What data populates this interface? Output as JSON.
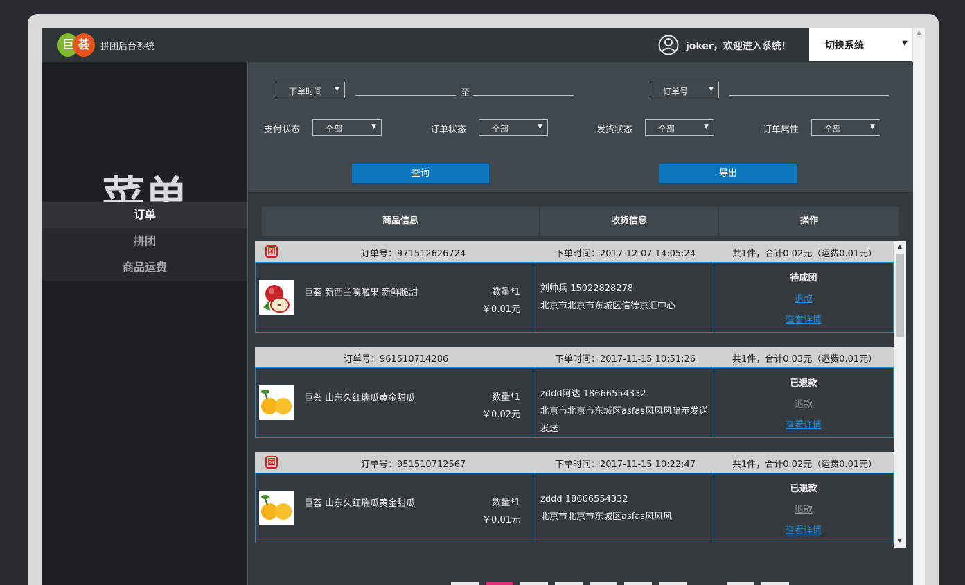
{
  "app": {
    "logo_left": "巨",
    "logo_right": "荟",
    "system_title": "拼团后台系统",
    "welcome": "joker，欢迎进入系统！",
    "switch_label": "切换系统"
  },
  "sidebar": {
    "title": "菜单",
    "items": [
      {
        "label": "订单",
        "active": true
      },
      {
        "label": "拼团",
        "active": false
      },
      {
        "label": "商品运费",
        "active": false
      }
    ]
  },
  "filters": {
    "time_select": "下单时间",
    "to_label": "至",
    "order_no_select": "订单号",
    "pay_status_label": "支付状态",
    "pay_status_value": "全部",
    "order_status_label": "订单状态",
    "order_status_value": "全部",
    "ship_status_label": "发货状态",
    "ship_status_value": "全部",
    "order_attr_label": "订单属性",
    "order_attr_value": "全部",
    "query_button": "查询",
    "export_button": "导出"
  },
  "table": {
    "headers": [
      "商品信息",
      "收货信息",
      "操作"
    ]
  },
  "orders": [
    {
      "group": true,
      "group_icon": "团",
      "order_no": "订单号：971512626724",
      "time": "下单时间：2017-12-07 14:05:24",
      "summary": "共1件，合计0.02元（运费0.01元）",
      "product": "巨荟 新西兰嘎啦果 新鲜脆甜",
      "qty": "数量*1",
      "price": "￥0.01元",
      "receiver": "刘帅兵 15022828278",
      "address": "北京市北京市东城区信德京汇中心",
      "status": "待成团",
      "refund": "退款",
      "refund_active": true,
      "detail": "查看详情",
      "thumb": "apple"
    },
    {
      "group": false,
      "group_icon": "",
      "order_no": "订单号：961510714286",
      "time": "下单时间：2017-11-15 10:51:26",
      "summary": "共1件，合计0.03元（运费0.01元）",
      "product": "巨荟 山东久红瑞瓜黄金甜瓜",
      "qty": "数量*1",
      "price": "￥0.02元",
      "receiver": "zddd阿达 18666554332",
      "address": "北京市北京市东城区asfas风风风暗示发送发送",
      "status": "已退款",
      "refund": "退款",
      "refund_active": false,
      "detail": "查看详情",
      "thumb": "melon"
    },
    {
      "group": true,
      "group_icon": "团",
      "order_no": "订单号：951510712567",
      "time": "下单时间：2017-11-15 10:22:47",
      "summary": "共1件，合计0.02元（运费0.01元）",
      "product": "巨荟 山东久红瑞瓜黄金甜瓜",
      "qty": "数量*1",
      "price": "￥0.01元",
      "receiver": "zddd 18666554332",
      "address": "北京市北京市东城区asfas风风风",
      "status": "已退款",
      "refund": "退款",
      "refund_active": false,
      "detail": "查看详情",
      "thumb": "melon"
    }
  ],
  "colors": {
    "accent": "#0d77bd",
    "link": "#1d8ad6",
    "group_badge": "#d71f1f",
    "border": "#1f87c2"
  }
}
